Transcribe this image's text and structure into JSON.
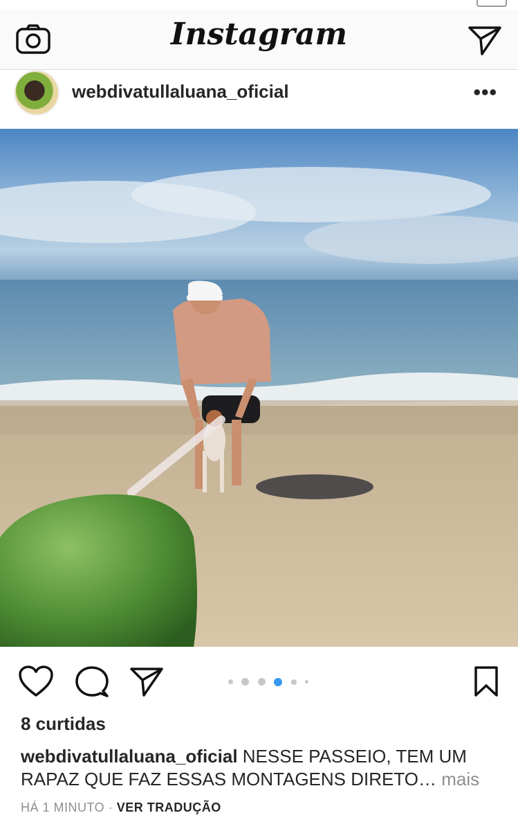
{
  "header": {
    "app_title": "Instagram",
    "camera_icon": "camera-icon",
    "direct_icon": "paper-plane-icon"
  },
  "post": {
    "username": "webdivatullaluana_oficial",
    "more_label": "•••",
    "likes": "8 curtidas",
    "caption_username": "webdivatullaluana_oficial",
    "caption_text": " NESSE PASSEIO, TEM UM RAPAZ QUE FAZ ESSAS MONTAGENS DIRETO… ",
    "caption_more": "mais",
    "time": "HÁ 1 MINUTO",
    "separator": " · ",
    "translate": "VER TRADUÇÃO",
    "carousel": {
      "count": 6,
      "active_index": 3
    }
  },
  "actions": {
    "like_icon": "heart-icon",
    "comment_icon": "comment-icon",
    "share_icon": "paper-plane-icon",
    "save_icon": "bookmark-icon"
  },
  "colors": {
    "text": "#262626",
    "muted": "#8e8e8e",
    "active_dot": "#3897f0",
    "inactive_dot": "#c7c7c7"
  }
}
